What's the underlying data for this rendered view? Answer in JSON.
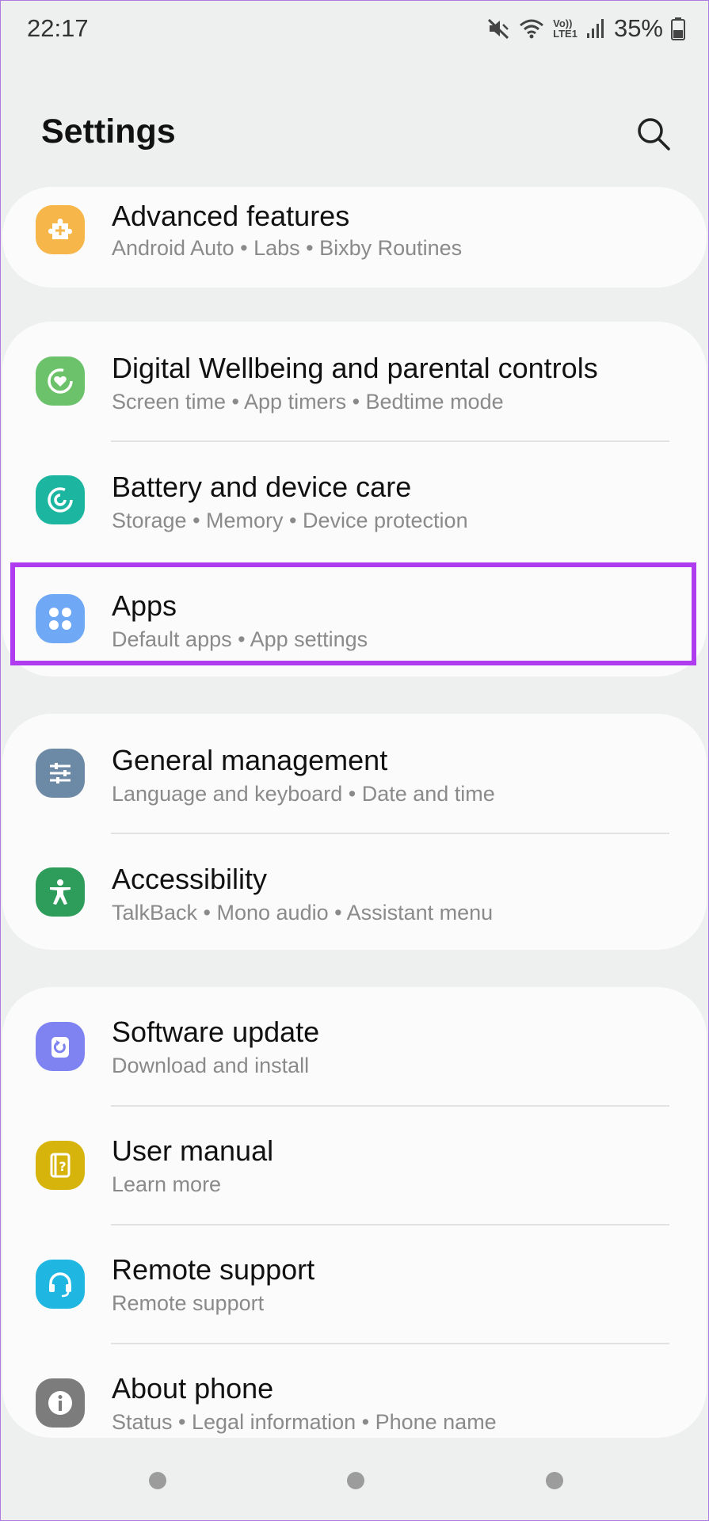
{
  "status_bar": {
    "time": "22:17",
    "network_label_top": "Vo))",
    "network_label_bottom": "LTE1",
    "battery_percent": "35%",
    "icons": [
      "mute-icon",
      "wifi-icon",
      "volte-icon",
      "signal-icon",
      "battery-icon"
    ]
  },
  "header": {
    "title": "Settings",
    "search_icon": "search-icon"
  },
  "groups": [
    {
      "items": [
        {
          "title": "Advanced features",
          "subtitle": "Android Auto  •  Labs  •  Bixby Routines",
          "icon": "puzzle-icon",
          "color": "#f6b64a"
        }
      ]
    },
    {
      "items": [
        {
          "title": "Digital Wellbeing and parental controls",
          "subtitle": "Screen time  •  App timers  •  Bedtime mode",
          "icon": "wellbeing-icon",
          "color": "#6cc26b"
        },
        {
          "title": "Battery and device care",
          "subtitle": "Storage  •  Memory  •  Device protection",
          "icon": "device-care-icon",
          "color": "#1bb5a0"
        },
        {
          "title": "Apps",
          "subtitle": "Default apps  •  App settings",
          "icon": "apps-grid-icon",
          "color": "#6fa8f5"
        }
      ]
    },
    {
      "items": [
        {
          "title": "General management",
          "subtitle": "Language and keyboard  •  Date and time",
          "icon": "sliders-icon",
          "color": "#6c89a6"
        },
        {
          "title": "Accessibility",
          "subtitle": "TalkBack  •  Mono audio  •  Assistant menu",
          "icon": "accessibility-icon",
          "color": "#2e9d5c"
        }
      ]
    },
    {
      "items": [
        {
          "title": "Software update",
          "subtitle": "Download and install",
          "icon": "update-icon",
          "color": "#7f83f2"
        },
        {
          "title": "User manual",
          "subtitle": "Learn more",
          "icon": "manual-icon",
          "color": "#d6b40c"
        },
        {
          "title": "Remote support",
          "subtitle": "Remote support",
          "icon": "headset-icon",
          "color": "#1fb7e2"
        },
        {
          "title": "About phone",
          "subtitle": "Status  •  Legal information  •  Phone name",
          "icon": "info-icon",
          "color": "#7c7c7c"
        }
      ]
    }
  ],
  "highlight_target": "Apps",
  "nav_bar": [
    "recent-apps-button",
    "home-button",
    "back-button"
  ]
}
